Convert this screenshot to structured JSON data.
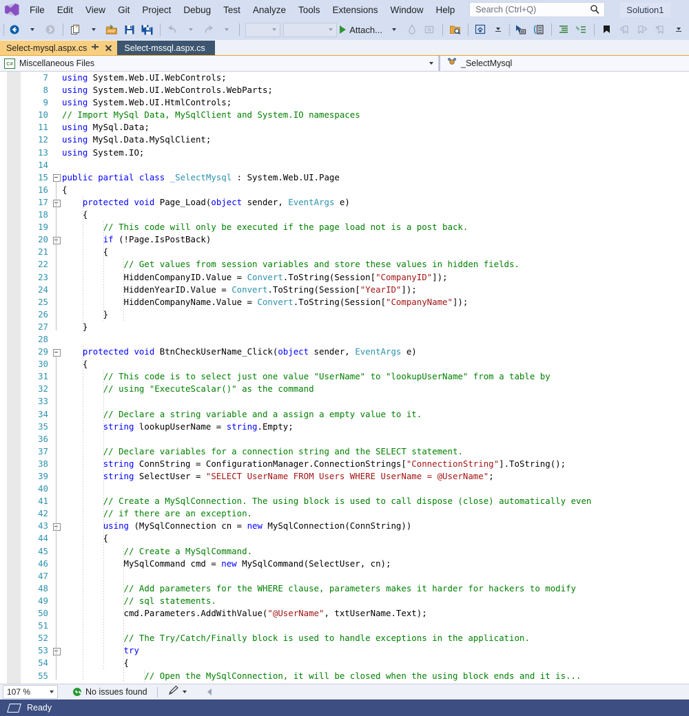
{
  "menu": {
    "logo_icon": "visual-studio-logo",
    "items": [
      "File",
      "Edit",
      "View",
      "Git",
      "Project",
      "Debug",
      "Test",
      "Analyze",
      "Tools",
      "Extensions",
      "Window",
      "Help"
    ],
    "search_placeholder": "Search (Ctrl+Q)",
    "search_value": "",
    "search_icon": "magnifier-icon",
    "solution_chip": "Solution1"
  },
  "toolbar": {
    "items": [
      {
        "name": "navigate-backward-button",
        "icon": "back-arrow-icon"
      },
      {
        "name": "navigate-backward-dropdown",
        "icon": "chevron-down-icon"
      },
      {
        "name": "navigate-forward-button",
        "icon": "forward-arrow-icon"
      },
      {
        "name": "new-file-button",
        "icon": "new-file-icon"
      },
      {
        "name": "new-file-dropdown",
        "icon": "chevron-down-icon"
      },
      {
        "name": "open-file-button",
        "icon": "open-folder-icon"
      },
      {
        "name": "save-button",
        "icon": "save-icon"
      },
      {
        "name": "save-all-button",
        "icon": "save-all-icon"
      },
      {
        "name": "undo-button",
        "icon": "undo-arrow-icon"
      },
      {
        "name": "undo-dropdown",
        "icon": "chevron-down-icon"
      },
      {
        "name": "redo-button",
        "icon": "redo-arrow-icon"
      },
      {
        "name": "redo-dropdown",
        "icon": "chevron-down-icon"
      }
    ],
    "combo_left_value": "",
    "combo_right_value": "",
    "attach_label": "Attach...",
    "attach_icon": "play-icon",
    "right_icons": [
      "hot-reload-icon",
      "preview-window-icon",
      "find-in-files-icon",
      "show-start-window-icon",
      "select-element-icon",
      "live-visual-tree-icon",
      "indent-icon",
      "comment-icon",
      "bookmark-icon",
      "prev-bookmark-icon",
      "next-bookmark-icon",
      "clear-bookmarks-icon"
    ],
    "overflow_icon": "toolbar-overflow-icon"
  },
  "tabs": [
    {
      "label": "Select-mysql.aspx.cs",
      "state": "active",
      "pin_icon": "pin-icon",
      "close_icon": "close-icon"
    },
    {
      "label": "Select-mssql.aspx.cs",
      "state": "preview"
    }
  ],
  "navbar": {
    "project_icon": "csharp-file-icon",
    "project": "Miscellaneous Files",
    "dropdown_icon": "chevron-down-icon",
    "member_icon": "class-icon",
    "member": "_SelectMysql"
  },
  "editor": {
    "first_line": 7,
    "lines": [
      {
        "n": 7,
        "indent": 0,
        "fold": "none",
        "tokens": [
          [
            "k",
            "using "
          ],
          [
            "p",
            "System.Web.UI.WebControls;"
          ]
        ]
      },
      {
        "n": 8,
        "indent": 0,
        "fold": "none",
        "tokens": [
          [
            "k",
            "using "
          ],
          [
            "p",
            "System.Web.UI.WebControls.WebParts;"
          ]
        ]
      },
      {
        "n": 9,
        "indent": 0,
        "fold": "none",
        "tokens": [
          [
            "k",
            "using "
          ],
          [
            "p",
            "System.Web.UI.HtmlControls;"
          ]
        ]
      },
      {
        "n": 10,
        "indent": 0,
        "fold": "none",
        "tokens": [
          [
            "c",
            "// Import MySql Data, MySqlClient and System.IO namespaces"
          ]
        ]
      },
      {
        "n": 11,
        "indent": 0,
        "fold": "none",
        "tokens": [
          [
            "k",
            "using "
          ],
          [
            "p",
            "MySql.Data;"
          ]
        ]
      },
      {
        "n": 12,
        "indent": 0,
        "fold": "none",
        "tokens": [
          [
            "k",
            "using "
          ],
          [
            "p",
            "MySql.Data.MySqlClient;"
          ]
        ]
      },
      {
        "n": 13,
        "indent": 0,
        "fold": "none",
        "tokens": [
          [
            "k",
            "using "
          ],
          [
            "p",
            "System.IO;"
          ]
        ]
      },
      {
        "n": 14,
        "indent": 0,
        "fold": "none",
        "tokens": []
      },
      {
        "n": 15,
        "indent": 0,
        "fold": "open",
        "tokens": [
          [
            "k",
            "public partial class "
          ],
          [
            "t",
            "_SelectMysql"
          ],
          [
            "p",
            " : System.Web.UI.Page"
          ]
        ]
      },
      {
        "n": 16,
        "indent": 0,
        "fold": "none",
        "tokens": [
          [
            "p",
            "{"
          ]
        ]
      },
      {
        "n": 17,
        "indent": 1,
        "fold": "open",
        "tokens": [
          [
            "p",
            "    "
          ],
          [
            "k",
            "protected void "
          ],
          [
            "p",
            "Page_Load("
          ],
          [
            "k",
            "object"
          ],
          [
            "p",
            " sender, "
          ],
          [
            "t",
            "EventArgs"
          ],
          [
            "p",
            " e)"
          ]
        ]
      },
      {
        "n": 18,
        "indent": 1,
        "fold": "none",
        "tokens": [
          [
            "p",
            "    {"
          ]
        ]
      },
      {
        "n": 19,
        "indent": 2,
        "fold": "none",
        "tokens": [
          [
            "p",
            "        "
          ],
          [
            "c",
            "// This code will only be executed if the page load not is a post back."
          ]
        ]
      },
      {
        "n": 20,
        "indent": 2,
        "fold": "open",
        "tokens": [
          [
            "p",
            "        "
          ],
          [
            "k",
            "if"
          ],
          [
            "p",
            " (!Page.IsPostBack)"
          ]
        ]
      },
      {
        "n": 21,
        "indent": 2,
        "fold": "none",
        "tokens": [
          [
            "p",
            "        {"
          ]
        ]
      },
      {
        "n": 22,
        "indent": 3,
        "fold": "none",
        "tokens": [
          [
            "p",
            "            "
          ],
          [
            "c",
            "// Get values from session variables and store these values in hidden fields."
          ]
        ]
      },
      {
        "n": 23,
        "indent": 3,
        "fold": "none",
        "tokens": [
          [
            "p",
            "            HiddenCompanyID.Value = "
          ],
          [
            "t",
            "Convert"
          ],
          [
            "p",
            ".ToString(Session["
          ],
          [
            "s",
            "\"CompanyID\""
          ],
          [
            "p",
            "]);"
          ]
        ]
      },
      {
        "n": 24,
        "indent": 3,
        "fold": "none",
        "tokens": [
          [
            "p",
            "            HiddenYearID.Value = "
          ],
          [
            "t",
            "Convert"
          ],
          [
            "p",
            ".ToString(Session["
          ],
          [
            "s",
            "\"YearID\""
          ],
          [
            "p",
            "]);"
          ]
        ]
      },
      {
        "n": 25,
        "indent": 3,
        "fold": "none",
        "tokens": [
          [
            "p",
            "            HiddenCompanyName.Value = "
          ],
          [
            "t",
            "Convert"
          ],
          [
            "p",
            ".ToString(Session["
          ],
          [
            "s",
            "\"CompanyName\""
          ],
          [
            "p",
            "]);"
          ]
        ]
      },
      {
        "n": 26,
        "indent": 2,
        "fold": "none",
        "tokens": [
          [
            "p",
            "        }"
          ]
        ]
      },
      {
        "n": 27,
        "indent": 1,
        "fold": "none",
        "tokens": [
          [
            "p",
            "    }"
          ]
        ]
      },
      {
        "n": 28,
        "indent": 0,
        "fold": "none",
        "tokens": []
      },
      {
        "n": 29,
        "indent": 1,
        "fold": "open",
        "tokens": [
          [
            "p",
            "    "
          ],
          [
            "k",
            "protected void "
          ],
          [
            "p",
            "BtnCheckUserName_Click("
          ],
          [
            "k",
            "object"
          ],
          [
            "p",
            " sender, "
          ],
          [
            "t",
            "EventArgs"
          ],
          [
            "p",
            " e)"
          ]
        ]
      },
      {
        "n": 30,
        "indent": 1,
        "fold": "none",
        "tokens": [
          [
            "p",
            "    {"
          ]
        ]
      },
      {
        "n": 31,
        "indent": 2,
        "fold": "none",
        "tokens": [
          [
            "p",
            "        "
          ],
          [
            "c",
            "// This code is to select just one value \"UserName\" to \"lookupUserName\" from a table by"
          ]
        ]
      },
      {
        "n": 32,
        "indent": 2,
        "fold": "none",
        "tokens": [
          [
            "p",
            "        "
          ],
          [
            "c",
            "// using \"ExecuteScalar()\" as the command"
          ]
        ]
      },
      {
        "n": 33,
        "indent": 2,
        "fold": "none",
        "tokens": []
      },
      {
        "n": 34,
        "indent": 2,
        "fold": "none",
        "tokens": [
          [
            "p",
            "        "
          ],
          [
            "c",
            "// Declare a string variable and a assign a empty value to it."
          ]
        ]
      },
      {
        "n": 35,
        "indent": 2,
        "fold": "none",
        "tokens": [
          [
            "p",
            "        "
          ],
          [
            "k",
            "string"
          ],
          [
            "p",
            " lookupUserName = "
          ],
          [
            "k",
            "string"
          ],
          [
            "p",
            ".Empty;"
          ]
        ]
      },
      {
        "n": 36,
        "indent": 2,
        "fold": "none",
        "tokens": []
      },
      {
        "n": 37,
        "indent": 2,
        "fold": "none",
        "tokens": [
          [
            "p",
            "        "
          ],
          [
            "c",
            "// Declare variables for a connection string and the SELECT statement."
          ]
        ]
      },
      {
        "n": 38,
        "indent": 2,
        "fold": "none",
        "tokens": [
          [
            "p",
            "        "
          ],
          [
            "k",
            "string"
          ],
          [
            "p",
            " ConnString = ConfigurationManager.ConnectionStrings["
          ],
          [
            "s",
            "\"ConnectionString\""
          ],
          [
            "p",
            "].ToString();"
          ]
        ]
      },
      {
        "n": 39,
        "indent": 2,
        "fold": "none",
        "tokens": [
          [
            "p",
            "        "
          ],
          [
            "k",
            "string"
          ],
          [
            "p",
            " SelectUser = "
          ],
          [
            "s",
            "\"SELECT UserName FROM Users WHERE UserName = @UserName\""
          ],
          [
            "p",
            ";"
          ]
        ]
      },
      {
        "n": 40,
        "indent": 2,
        "fold": "none",
        "tokens": []
      },
      {
        "n": 41,
        "indent": 2,
        "fold": "none",
        "tokens": [
          [
            "p",
            "        "
          ],
          [
            "c",
            "// Create a MySqlConnection. The using block is used to call dispose (close) automatically even"
          ]
        ]
      },
      {
        "n": 42,
        "indent": 2,
        "fold": "none",
        "tokens": [
          [
            "p",
            "        "
          ],
          [
            "c",
            "// if there are an exception."
          ]
        ]
      },
      {
        "n": 43,
        "indent": 2,
        "fold": "open",
        "tokens": [
          [
            "p",
            "        "
          ],
          [
            "k",
            "using"
          ],
          [
            "p",
            " (MySqlConnection cn = "
          ],
          [
            "k",
            "new"
          ],
          [
            "p",
            " MySqlConnection(ConnString))"
          ]
        ]
      },
      {
        "n": 44,
        "indent": 2,
        "fold": "none",
        "tokens": [
          [
            "p",
            "        {"
          ]
        ]
      },
      {
        "n": 45,
        "indent": 3,
        "fold": "none",
        "tokens": [
          [
            "p",
            "            "
          ],
          [
            "c",
            "// Create a MySqlCommand."
          ]
        ]
      },
      {
        "n": 46,
        "indent": 3,
        "fold": "none",
        "tokens": [
          [
            "p",
            "            MySqlCommand cmd = "
          ],
          [
            "k",
            "new"
          ],
          [
            "p",
            " MySqlCommand(SelectUser, cn);"
          ]
        ]
      },
      {
        "n": 47,
        "indent": 3,
        "fold": "none",
        "tokens": []
      },
      {
        "n": 48,
        "indent": 3,
        "fold": "none",
        "tokens": [
          [
            "p",
            "            "
          ],
          [
            "c",
            "// Add parameters for the WHERE clause, parameters makes it harder for hackers to modify"
          ]
        ]
      },
      {
        "n": 49,
        "indent": 3,
        "fold": "none",
        "tokens": [
          [
            "p",
            "            "
          ],
          [
            "c",
            "// sql statements."
          ]
        ]
      },
      {
        "n": 50,
        "indent": 3,
        "fold": "none",
        "tokens": [
          [
            "p",
            "            cmd.Parameters.AddWithValue("
          ],
          [
            "s",
            "\"@UserName\""
          ],
          [
            "p",
            ", txtUserName.Text);"
          ]
        ]
      },
      {
        "n": 51,
        "indent": 3,
        "fold": "none",
        "tokens": []
      },
      {
        "n": 52,
        "indent": 3,
        "fold": "none",
        "tokens": [
          [
            "p",
            "            "
          ],
          [
            "c",
            "// The Try/Catch/Finally block is used to handle exceptions in the application."
          ]
        ]
      },
      {
        "n": 53,
        "indent": 3,
        "fold": "open",
        "tokens": [
          [
            "p",
            "            "
          ],
          [
            "k",
            "try"
          ]
        ]
      },
      {
        "n": 54,
        "indent": 3,
        "fold": "none",
        "tokens": [
          [
            "p",
            "            {"
          ]
        ]
      },
      {
        "n": 55,
        "indent": 4,
        "fold": "none",
        "tokens": [
          [
            "p",
            "                "
          ],
          [
            "c",
            "// Open the MySqlConnection, it will be closed when the using block ends and it is..."
          ]
        ]
      }
    ]
  },
  "edit_status": {
    "zoom": "107 %",
    "zoom_caret_icon": "chevron-down-icon",
    "issues_icon": "check-circle-icon",
    "issues_text": "No issues found",
    "pen_icon": "pen-icon",
    "pen_caret_icon": "chevron-down-icon",
    "collapse_icon": "left-caret-icon"
  },
  "status_bar": {
    "icon": "ready-parallelogram-icon",
    "text": "Ready"
  }
}
